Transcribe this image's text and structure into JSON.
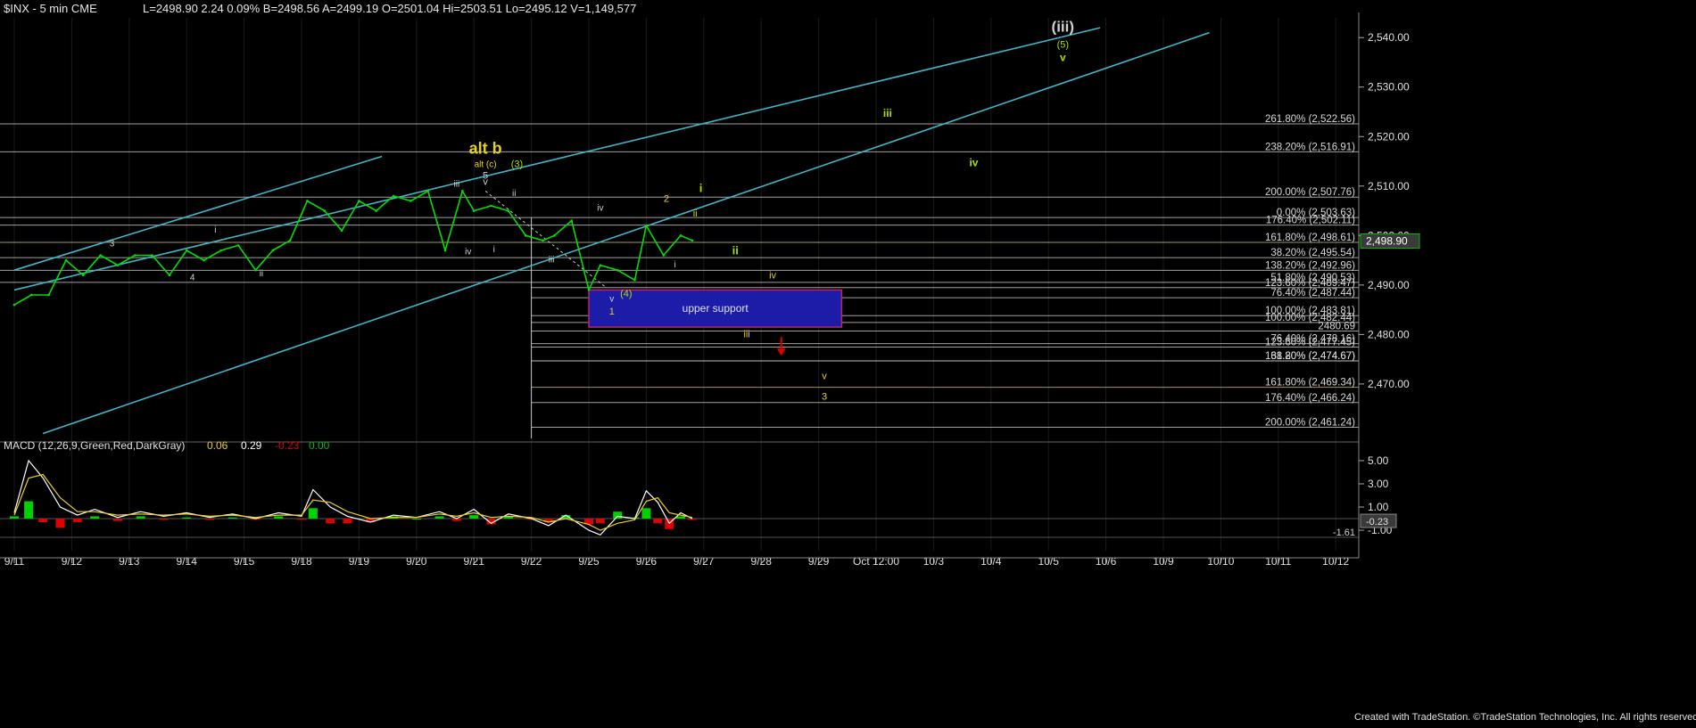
{
  "header": {
    "symbol": "$INX - 5 min  CME",
    "quote": "L=2498.90  2.24  0.09%  B=2498.56  A=2499.19  O=2501.04  Hi=2503.51  Lo=2495.12  V=1,149,577"
  },
  "colors": {
    "background": "#000000",
    "price": "#00e000",
    "channel": "#3fb6c8",
    "fib": "#c8c8c8",
    "support_fill": "#1c1ca8",
    "support_border": "#c0206a",
    "wave_yellow": "#e8d020",
    "wave_green": "#a8e000",
    "wave_white": "#d0d0d0",
    "macd_up": "#00d000",
    "macd_down": "#e00000",
    "arrow": "#e00000"
  },
  "footer": {
    "credit": "Created with TradeStation. ©TradeStation Technologies, Inc. All rights reserved."
  },
  "chart_data": [
    {
      "type": "line",
      "panel": "price",
      "ylim": [
        2459,
        2544
      ],
      "y_ticks": [
        2540,
        2530,
        2520,
        2510,
        2500,
        2490,
        2480,
        2470
      ],
      "y_tick_labels": [
        "2,540.00",
        "2,530.00",
        "2,520.00",
        "2,510.00",
        "2,500.00",
        "2,490.00",
        "2,480.00",
        "2,470.00"
      ],
      "last_price": 2498.9,
      "last_price_label": "2,498.90",
      "x_labels": [
        "9/11",
        "9/12",
        "9/13",
        "9/14",
        "9/15",
        "9/18",
        "9/19",
        "9/20",
        "9/21",
        "9/22",
        "9/25",
        "9/26",
        "9/27",
        "9/28",
        "9/29",
        "Oct 12:00",
        "10/3",
        "10/4",
        "10/5",
        "10/6",
        "10/9",
        "10/10",
        "10/11",
        "10/12"
      ],
      "series": [
        {
          "x": [
            0.0,
            0.3,
            0.6,
            0.9,
            1.2,
            1.5,
            1.8,
            2.1,
            2.4,
            2.7,
            3.0,
            3.3,
            3.6,
            3.9,
            4.2,
            4.5,
            4.8,
            5.1,
            5.4,
            5.7,
            6.0,
            6.3,
            6.6,
            6.9,
            7.2,
            7.5,
            7.8,
            8.0,
            8.3,
            8.6,
            8.9,
            9.2,
            9.4,
            9.7,
            10.0,
            10.2,
            10.5,
            10.8,
            11.0,
            11.3,
            11.6,
            11.8
          ],
          "values": [
            2486,
            2488,
            2488,
            2495,
            2492,
            2496,
            2494,
            2496,
            2496,
            2492,
            2497,
            2495,
            2497,
            2498,
            2493,
            2497,
            2499,
            2507,
            2505,
            2501,
            2507,
            2505,
            2508,
            2507,
            2509,
            2497,
            2509,
            2505,
            2506,
            2505,
            2500,
            2499,
            2500,
            2503,
            2489,
            2494,
            2493,
            2491,
            2502,
            2496,
            2500,
            2499
          ]
        }
      ],
      "fib_levels": [
        {
          "label": "261.80% (2,522.56)",
          "value": 2522.56
        },
        {
          "label": "238.20% (2,516.91)",
          "value": 2516.91
        },
        {
          "label": "200.00% (2,507.76)",
          "value": 2507.76
        },
        {
          "label": "0.00% (2,503.63)",
          "value": 2503.63
        },
        {
          "label": "176.40% (2,502.11)",
          "value": 2502.11
        },
        {
          "label": "161.80% (2,498.61)",
          "value": 2498.61
        },
        {
          "label": "38.20% (2,495.54)",
          "value": 2495.54
        },
        {
          "label": "138.20% (2,492.96)",
          "value": 2492.96
        },
        {
          "label": "51.80% (2,490.53)",
          "value": 2490.53
        },
        {
          "label": "123.60% (2,489.47)",
          "value": 2489.47
        },
        {
          "label": "76.40% (2,487.44)",
          "value": 2487.44
        },
        {
          "label": "100.00% (2,483.81)",
          "value": 2483.81
        },
        {
          "label": "100.00% (2,482.44)",
          "value": 2482.44
        },
        {
          "label": "2480.69",
          "value": 2480.69
        },
        {
          "label": "76.40% (2,478.16)",
          "value": 2478.16
        },
        {
          "label": "123.60% (2,477.45)",
          "value": 2477.45
        },
        {
          "label": "61.80% (2,474.67)",
          "value": 2474.67
        },
        {
          "label": "138.20% (2,474.67)",
          "value": 2474.67
        },
        {
          "label": "161.80% (2,469.34)",
          "value": 2469.34
        },
        {
          "label": "176.40% (2,466.24)",
          "value": 2466.24
        },
        {
          "label": "200.00% (2,461.24)",
          "value": 2461.24
        }
      ],
      "channel_lines": [
        {
          "x1": 0.0,
          "y1": 2493,
          "x2": 6.4,
          "y2": 2516
        },
        {
          "x1": 0.0,
          "y1": 2489,
          "x2": 18.9,
          "y2": 2542
        },
        {
          "x1": 0.5,
          "y1": 2460,
          "x2": 20.8,
          "y2": 2541
        }
      ],
      "support_zone": {
        "label": "upper support",
        "x1": 10.0,
        "x2": 14.4,
        "y1": 2481.5,
        "y2": 2489
      }
    },
    {
      "type": "line",
      "panel": "macd",
      "title": "MACD (12,26,9,Green,Red,DarkGray)",
      "values_text": [
        "0.06",
        "0.29",
        "-0.23",
        "0.00"
      ],
      "ylim": [
        -2.3,
        6.3
      ],
      "y_ticks": [
        5,
        3,
        1,
        -1
      ],
      "y_tick_labels": [
        "5.00",
        "3.00",
        "1.00",
        "-1.00"
      ],
      "last_value_label": "-0.23",
      "ref_label": "-1.61",
      "ref_value": -1.61,
      "x": [
        0.0,
        0.25,
        0.5,
        0.8,
        1.1,
        1.4,
        1.8,
        2.2,
        2.6,
        3.0,
        3.4,
        3.8,
        4.2,
        4.6,
        5.0,
        5.2,
        5.5,
        5.8,
        6.2,
        6.6,
        7.0,
        7.4,
        7.7,
        8.0,
        8.3,
        8.6,
        9.0,
        9.3,
        9.6,
        10.0,
        10.2,
        10.5,
        10.8,
        11.0,
        11.2,
        11.4,
        11.6,
        11.8
      ],
      "macd": [
        0.5,
        5.0,
        3.5,
        1.0,
        0.3,
        0.8,
        0.1,
        0.6,
        0.2,
        0.5,
        0.1,
        0.4,
        0.0,
        0.5,
        0.2,
        2.5,
        1.0,
        0.2,
        -0.3,
        0.3,
        0.1,
        0.6,
        0.0,
        0.8,
        -0.4,
        0.4,
        0.0,
        -0.6,
        0.3,
        -1.0,
        -1.4,
        0.2,
        0.0,
        2.4,
        1.4,
        -0.4,
        0.5,
        0.0
      ],
      "signal": [
        0.3,
        3.5,
        3.8,
        1.8,
        0.6,
        0.6,
        0.3,
        0.4,
        0.3,
        0.4,
        0.2,
        0.3,
        0.1,
        0.3,
        0.3,
        1.6,
        1.4,
        0.6,
        0.0,
        0.1,
        0.1,
        0.4,
        0.2,
        0.5,
        0.1,
        0.2,
        0.1,
        -0.3,
        0.0,
        -0.5,
        -1.0,
        -0.4,
        -0.1,
        1.5,
        1.8,
        0.5,
        0.3,
        0.1
      ]
    }
  ],
  "wave_labels": [
    {
      "text": "(iii)",
      "x": 18.25,
      "y": 2541.2,
      "color": "wave_white",
      "size": 17,
      "bold": true
    },
    {
      "text": "(5)",
      "x": 18.25,
      "y": 2538.0,
      "color": "wave_green",
      "size": 11
    },
    {
      "text": "v",
      "x": 18.25,
      "y": 2535.3,
      "color": "wave_green",
      "size": 12,
      "bold": true
    },
    {
      "text": "iii",
      "x": 15.2,
      "y": 2524.0,
      "color": "wave_green",
      "size": 12,
      "bold": true
    },
    {
      "text": "iv",
      "x": 16.7,
      "y": 2514.0,
      "color": "wave_green",
      "size": 12,
      "bold": true
    },
    {
      "text": "alt b",
      "x": 8.2,
      "y": 2516.5,
      "color": "wave_yellow",
      "size": 18,
      "bold": true
    },
    {
      "text": "alt (c)",
      "x": 8.2,
      "y": 2513.8,
      "color": "wave_yellow",
      "size": 10
    },
    {
      "text": "(3)",
      "x": 8.75,
      "y": 2513.8,
      "color": "wave_green",
      "size": 11
    },
    {
      "text": "5",
      "x": 8.2,
      "y": 2511.5,
      "color": "wave_white",
      "size": 11
    },
    {
      "text": "v",
      "x": 8.2,
      "y": 2510.2,
      "color": "wave_white",
      "size": 11
    },
    {
      "text": "iii",
      "x": 7.7,
      "y": 2509.9,
      "color": "wave_white",
      "size": 10
    },
    {
      "text": "ii",
      "x": 8.7,
      "y": 2508.0,
      "color": "wave_white",
      "size": 10
    },
    {
      "text": "iv",
      "x": 7.9,
      "y": 2496.2,
      "color": "wave_white",
      "size": 10
    },
    {
      "text": "i",
      "x": 8.35,
      "y": 2496.6,
      "color": "wave_white",
      "size": 10
    },
    {
      "text": "3",
      "x": 1.7,
      "y": 2497.8,
      "color": "wave_white",
      "size": 10
    },
    {
      "text": "i",
      "x": 3.5,
      "y": 2500.6,
      "color": "wave_white",
      "size": 10
    },
    {
      "text": "4",
      "x": 3.1,
      "y": 2491.0,
      "color": "wave_white",
      "size": 10
    },
    {
      "text": "ii",
      "x": 4.3,
      "y": 2491.8,
      "color": "wave_white",
      "size": 10
    },
    {
      "text": "iii",
      "x": 9.35,
      "y": 2494.6,
      "color": "wave_white",
      "size": 10
    },
    {
      "text": "iv",
      "x": 10.2,
      "y": 2505.0,
      "color": "wave_white",
      "size": 10
    },
    {
      "text": "v",
      "x": 10.4,
      "y": 2486.6,
      "color": "wave_white",
      "size": 10
    },
    {
      "text": "(4)",
      "x": 10.65,
      "y": 2487.6,
      "color": "wave_green",
      "size": 11
    },
    {
      "text": "1",
      "x": 10.4,
      "y": 2484.0,
      "color": "wave_yellow",
      "size": 11
    },
    {
      "text": "2",
      "x": 11.35,
      "y": 2506.8,
      "color": "wave_yellow",
      "size": 11
    },
    {
      "text": "ii",
      "x": 11.85,
      "y": 2503.8,
      "color": "wave_yellow",
      "size": 11
    },
    {
      "text": "i",
      "x": 11.5,
      "y": 2493.6,
      "color": "wave_white",
      "size": 10
    },
    {
      "text": "i",
      "x": 11.95,
      "y": 2508.8,
      "color": "wave_green",
      "size": 13,
      "bold": true
    },
    {
      "text": "ii",
      "x": 12.55,
      "y": 2496.2,
      "color": "wave_green",
      "size": 13,
      "bold": true
    },
    {
      "text": "iv",
      "x": 13.2,
      "y": 2491.3,
      "color": "wave_yellow",
      "size": 11
    },
    {
      "text": "iii",
      "x": 12.75,
      "y": 2479.4,
      "color": "wave_yellow",
      "size": 11
    },
    {
      "text": "v",
      "x": 14.1,
      "y": 2471.0,
      "color": "wave_yellow",
      "size": 11
    },
    {
      "text": "3",
      "x": 14.1,
      "y": 2466.8,
      "color": "wave_yellow",
      "size": 11
    }
  ]
}
